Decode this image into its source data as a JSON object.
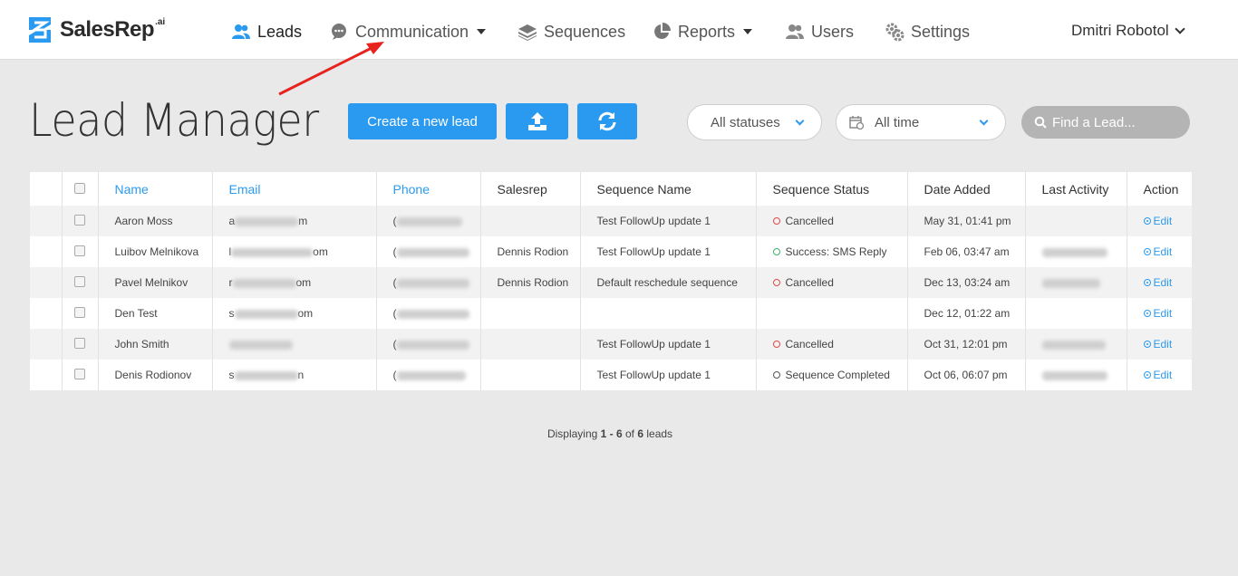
{
  "brand": {
    "name": "SalesRep",
    "suffix": ".ai",
    "color": "#2a9af0"
  },
  "nav": {
    "leads": "Leads",
    "communication": "Communication",
    "sequences": "Sequences",
    "reports": "Reports",
    "users": "Users",
    "settings": "Settings",
    "user": "Dmitri Robotol"
  },
  "page": {
    "title": "Lead Manager",
    "create_button": "Create a new lead",
    "status_filter": "All statuses",
    "time_filter": "All time",
    "search_placeholder": "Find a Lead..."
  },
  "table": {
    "headers": {
      "name": "Name",
      "email": "Email",
      "phone": "Phone",
      "salesrep": "Salesrep",
      "sequence_name": "Sequence Name",
      "sequence_status": "Sequence Status",
      "date_added": "Date Added",
      "last_activity": "Last Activity",
      "action": "Action"
    },
    "rows": [
      {
        "name": "Aaron Moss",
        "email_prefix": "a",
        "email_suffix": "m",
        "phone_prefix": "(",
        "salesrep": "",
        "sequence": "Test FollowUp update 1",
        "status": "Cancelled",
        "status_color": "#e04848",
        "date": "May 31, 01:41 pm",
        "edit": "Edit"
      },
      {
        "name": "Luibov Melnikova",
        "email_prefix": "l",
        "email_suffix": "om",
        "phone_prefix": "(",
        "salesrep": "Dennis Rodion",
        "sequence": "Test FollowUp update 1",
        "status": "Success: SMS Reply",
        "status_color": "#3bb36b",
        "date": "Feb 06, 03:47 am",
        "edit": "Edit"
      },
      {
        "name": "Pavel Melnikov",
        "email_prefix": "r",
        "email_suffix": "om",
        "phone_prefix": "(",
        "salesrep": "Dennis Rodion",
        "sequence": "Default reschedule sequence",
        "status": "Cancelled",
        "status_color": "#e04848",
        "date": "Dec 13, 03:24 am",
        "edit": "Edit"
      },
      {
        "name": "Den Test",
        "email_prefix": "s",
        "email_suffix": "om",
        "phone_prefix": "(",
        "salesrep": "",
        "sequence": "",
        "status": "",
        "status_color": "",
        "date": "Dec 12, 01:22 am",
        "edit": "Edit"
      },
      {
        "name": "John Smith",
        "email_prefix": "",
        "email_suffix": "",
        "phone_prefix": "(",
        "salesrep": "",
        "sequence": "Test FollowUp update 1",
        "status": "Cancelled",
        "status_color": "#e04848",
        "date": "Oct 31, 12:01 pm",
        "edit": "Edit"
      },
      {
        "name": "Denis Rodionov",
        "email_prefix": "s",
        "email_suffix": "n",
        "phone_prefix": "(",
        "salesrep": "",
        "sequence": "Test FollowUp update 1",
        "status": "Sequence Completed",
        "status_color": "#555555",
        "date": "Oct 06, 06:07 pm",
        "edit": "Edit"
      }
    ]
  },
  "pagination": {
    "prefix": "Displaying ",
    "range": "1 - 6",
    "middle": " of ",
    "total": "6",
    "suffix": " leads"
  }
}
